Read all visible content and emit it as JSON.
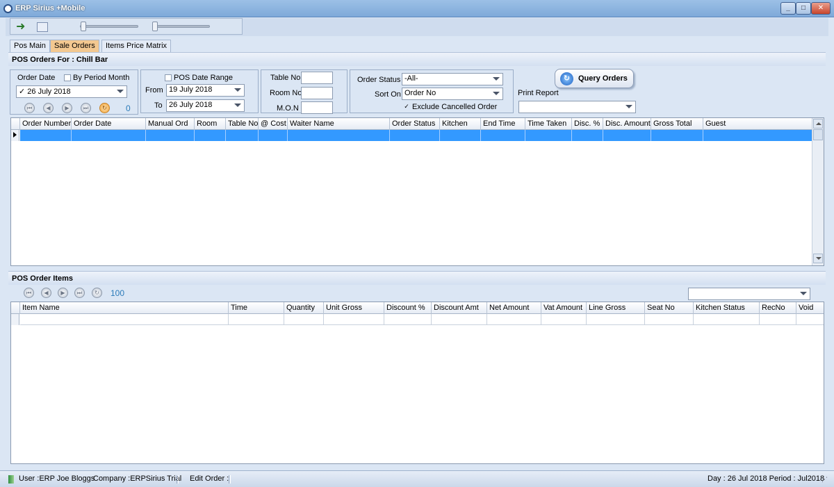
{
  "window": {
    "title": "ERP Sirius +Mobile",
    "min": "_",
    "max": "□",
    "close": "✕"
  },
  "tabs": [
    "Pos Main",
    "Sale Orders",
    "Items Price Matrix"
  ],
  "orders_panel": {
    "title": "POS Orders For : Chill Bar",
    "order_date_label": "Order Date",
    "by_period_month_label": "By Period Month",
    "order_date_value": "26 July 2018",
    "order_date_check": "✓",
    "nav_count": "0",
    "pos_date_range_label": "POS Date Range",
    "from_label": "From",
    "from_value": "19 July 2018",
    "to_label": "To",
    "to_value": "26 July 2018",
    "table_no_label": "Table No",
    "room_no_label": "Room No",
    "mon_label": "M.O.N",
    "order_status_label": "Order Status",
    "order_status_value": "-All-",
    "sort_on_label": "Sort On",
    "sort_on_value": "Order No",
    "exclude_cancelled_label": "Exclude Cancelled Order",
    "exclude_cancelled_check": "✓",
    "query_button": "Query Orders",
    "print_report_label": "Print Report",
    "print_report_value": ""
  },
  "orders_grid": {
    "columns": [
      "Order Number",
      "Order Date",
      "Manual Ord",
      "Room",
      "Table No",
      "@ Cost",
      "Waiter Name",
      "Order Status",
      "Kitchen",
      "End Time",
      "Time Taken",
      "Disc. %",
      "Disc. Amount",
      "Gross Total",
      "Guest"
    ]
  },
  "items_panel": {
    "title": "POS Order Items",
    "nav_count": "100",
    "filter_value": ""
  },
  "items_grid": {
    "columns": [
      "Item Name",
      "Time",
      "Quantity",
      "Unit Gross",
      "Discount %",
      "Discount Amt",
      "Net Amount",
      "Vat Amount",
      "Line Gross",
      "Seat No",
      "Kitchen Status",
      "RecNo",
      "Void"
    ]
  },
  "status": {
    "user": "User :ERP Joe Bloggs",
    "company": "Company :ERPSirius Trial",
    "edit_order": "Edit Order :",
    "day_period": "Day : 26 Jul 2018  Period : Jul2018"
  }
}
